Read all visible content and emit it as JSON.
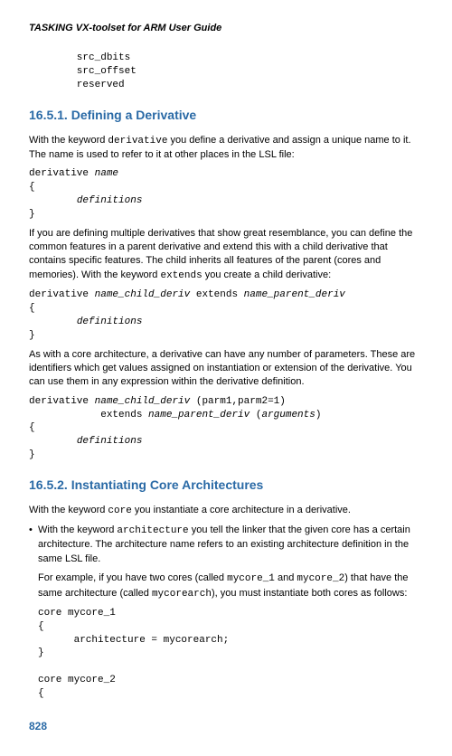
{
  "docTitle": "TASKING VX-toolset for ARM User Guide",
  "topCode": "        src_dbits\n        src_offset\n        reserved",
  "sec1": {
    "heading": "16.5.1. Defining a Derivative",
    "p1a": "With the keyword ",
    "p1kw": "derivative",
    "p1b": " you define a derivative and assign a unique name to it. The name is used to refer to it at other places in the LSL file:",
    "code1_pre": "derivative ",
    "code1_name": "name",
    "code1_body": "\n{\n        ",
    "code1_defs": "definitions",
    "code1_end": "\n}",
    "p2a": "If you are defining multiple derivatives that show great resemblance, you can define the common features in a parent derivative and extend this with a child derivative that contains specific features. The child inherits all features of the parent (cores and memories). With the keyword ",
    "p2kw": "extends",
    "p2b": " you create a child derivative:",
    "code2_a": "derivative ",
    "code2_child": "name_child_deriv",
    "code2_b": " extends ",
    "code2_parent": "name_parent_deriv",
    "code2_body": "\n{\n        ",
    "code2_defs": "definitions",
    "code2_end": "\n}",
    "p3": "As with a core architecture, a derivative can have any number of parameters. These are identifiers which get values assigned on instantiation or extension of the derivative. You can use them in any expression within the derivative definition.",
    "code3_a": "derivative ",
    "code3_child": "name_child_deriv",
    "code3_b": " (parm1,parm2=1)\n            extends ",
    "code3_parent": "name_parent_deriv",
    "code3_c": " (",
    "code3_args": "arguments",
    "code3_d": ")\n{\n        ",
    "code3_defs": "definitions",
    "code3_end": "\n}"
  },
  "sec2": {
    "heading": "16.5.2. Instantiating Core Architectures",
    "p1a": "With the keyword ",
    "p1kw": "core",
    "p1b": " you instantiate a core architecture in a derivative.",
    "bullet_a": "With the keyword ",
    "bullet_kw": "architecture",
    "bullet_b": " you tell the linker that the given core has a certain architecture. The architecture name refers to an existing architecture definition in the same LSL file.",
    "ex_a": "For example, if you have two cores (called ",
    "ex_c1": "mycore_1",
    "ex_b": " and ",
    "ex_c2": "mycore_2",
    "ex_c": ") that have the same architecture (called ",
    "ex_arch": "mycorearch",
    "ex_d": "), you must instantiate both cores as follows:",
    "codeA": "core mycore_1\n{\n      architecture = mycorearch;\n}\n\ncore mycore_2\n{"
  },
  "pageNumber": "828"
}
